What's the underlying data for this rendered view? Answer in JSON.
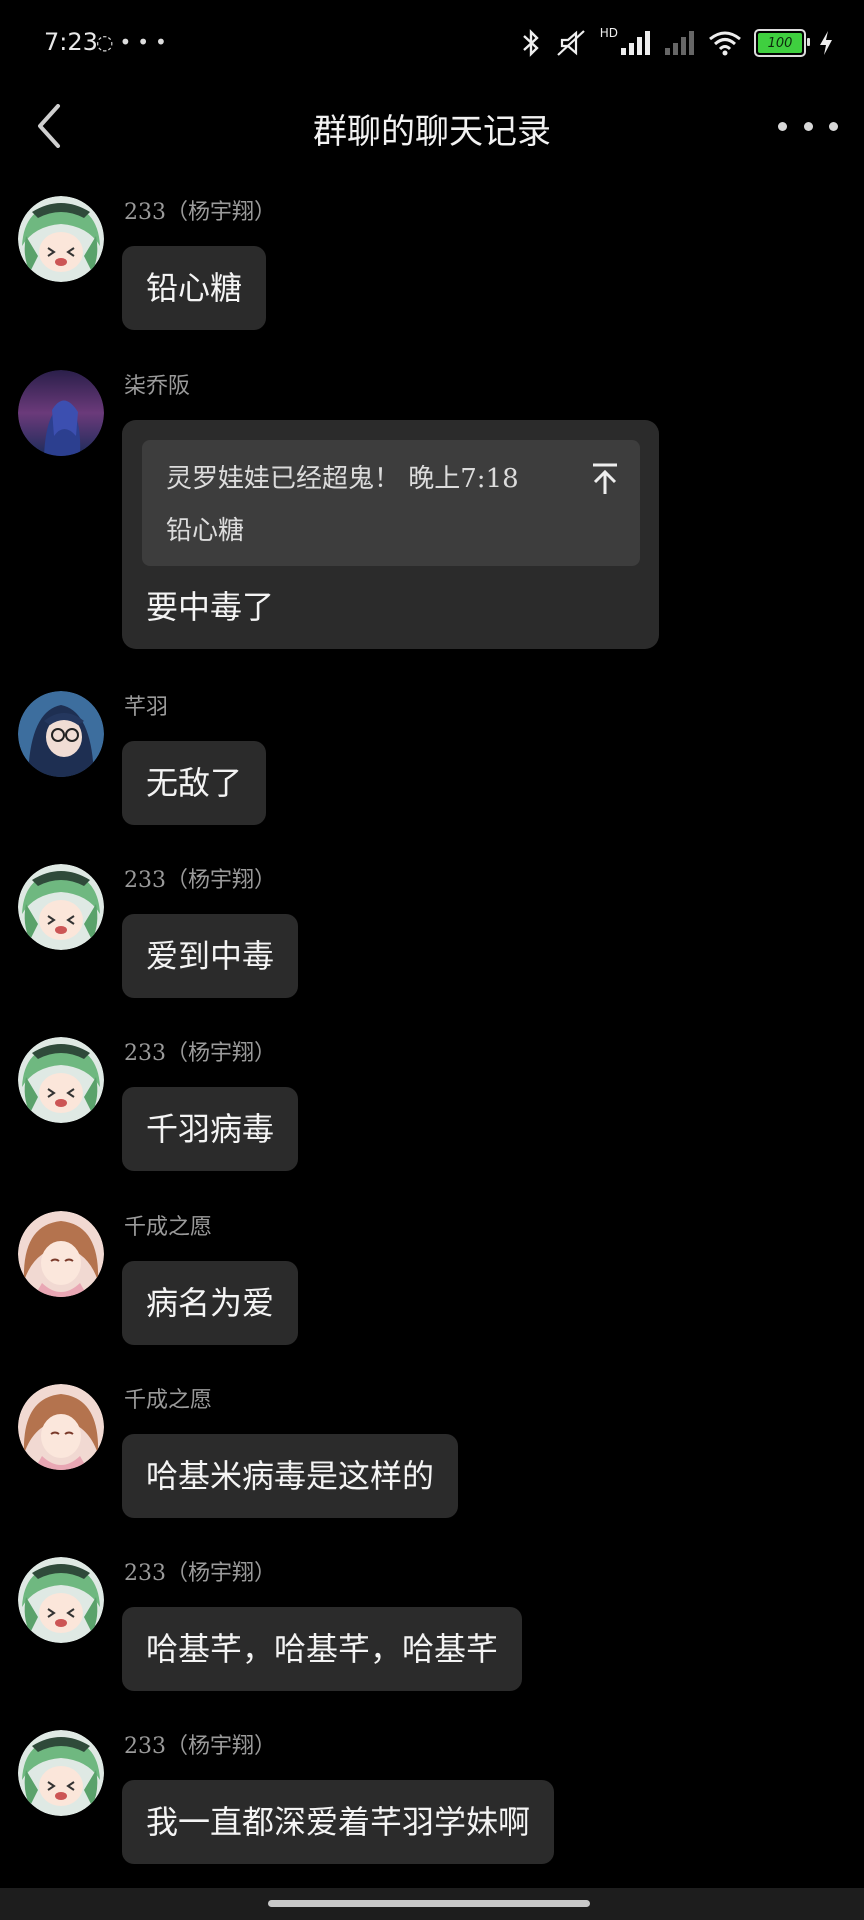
{
  "status_bar": {
    "time": "7:23",
    "left_icons": [
      "app-notification-icon",
      "more-dots-icon"
    ],
    "right_icons": [
      "bluetooth-icon",
      "mute-icon",
      "signal-icon",
      "signal-2-icon",
      "wifi-icon"
    ],
    "hd_label": "HD",
    "battery_level": "100",
    "battery_fraction": 1.0,
    "charging": true
  },
  "header": {
    "title": "群聊的聊天记录"
  },
  "messages": [
    {
      "sender": "233（杨宇翔）",
      "text": "铅心糖",
      "avatar": "green-hair-anime-avatar"
    },
    {
      "sender": "柒乔阪",
      "avatar": "dark-blue-anime-avatar",
      "quote": {
        "line1": "灵罗娃娃已经超鬼！ 晚上7:18",
        "line2": "铅心糖"
      },
      "text": "要中毒了"
    },
    {
      "sender": "芊羽",
      "text": "无敌了",
      "avatar": "blue-glasses-anime-avatar"
    },
    {
      "sender": "233（杨宇翔）",
      "text": "爱到中毒",
      "avatar": "green-hair-anime-avatar"
    },
    {
      "sender": "233（杨宇翔）",
      "text": "千羽病毒",
      "avatar": "green-hair-anime-avatar"
    },
    {
      "sender": "千成之愿",
      "text": "病名为爱",
      "avatar": "brown-hair-anime-avatar"
    },
    {
      "sender": "千成之愿",
      "text": "哈基米病毒是这样的",
      "avatar": "brown-hair-anime-avatar"
    },
    {
      "sender": "233（杨宇翔）",
      "text": "哈基芊，哈基芊，哈基芊",
      "avatar": "green-hair-anime-avatar"
    },
    {
      "sender": "233（杨宇翔）",
      "text": "我一直都深爱着芊羽学妹啊",
      "avatar": "green-hair-anime-avatar"
    }
  ],
  "colors": {
    "background": "#000000",
    "bubble": "#2b2b2b",
    "quote_box": "#3d3d3d",
    "sender_text": "#9a9a9a",
    "battery": "#3fcf3f"
  }
}
